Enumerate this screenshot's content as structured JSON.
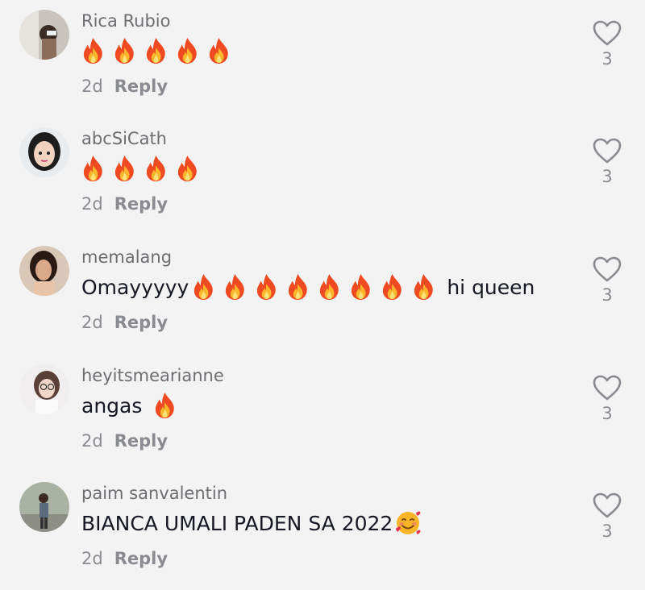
{
  "comments": [
    {
      "username": "Rica Rubio",
      "text": "",
      "fire_count": 5,
      "trailing_text": "",
      "time": "2d",
      "reply_label": "Reply",
      "likes": "3"
    },
    {
      "username": "abcSiCath",
      "text": "",
      "fire_count": 4,
      "trailing_text": "",
      "time": "2d",
      "reply_label": "Reply",
      "likes": "3"
    },
    {
      "username": "memalang",
      "text": "Omayyyyy",
      "fire_count": 8,
      "trailing_text": "hi queen",
      "time": "2d",
      "reply_label": "Reply",
      "likes": "3"
    },
    {
      "username": "heyitsmearianne",
      "text": "angas",
      "fire_count": 1,
      "trailing_text": "",
      "time": "2d",
      "reply_label": "Reply",
      "likes": "3"
    },
    {
      "username": "paim sanvalentin",
      "text": "BIANCA UMALI PADEN SA 2022",
      "fire_count": 0,
      "emoji": "smiling-face-with-hearts",
      "trailing_text": "",
      "time": "2d",
      "reply_label": "Reply",
      "likes": "3"
    }
  ],
  "colors": {
    "background": "#f3f3f3",
    "text": "#161823",
    "secondary": "#8a8b91"
  },
  "icons": {
    "like": "heart-outline-icon",
    "fire": "fire-emoji",
    "smile": "smiling-face-with-hearts-emoji"
  }
}
